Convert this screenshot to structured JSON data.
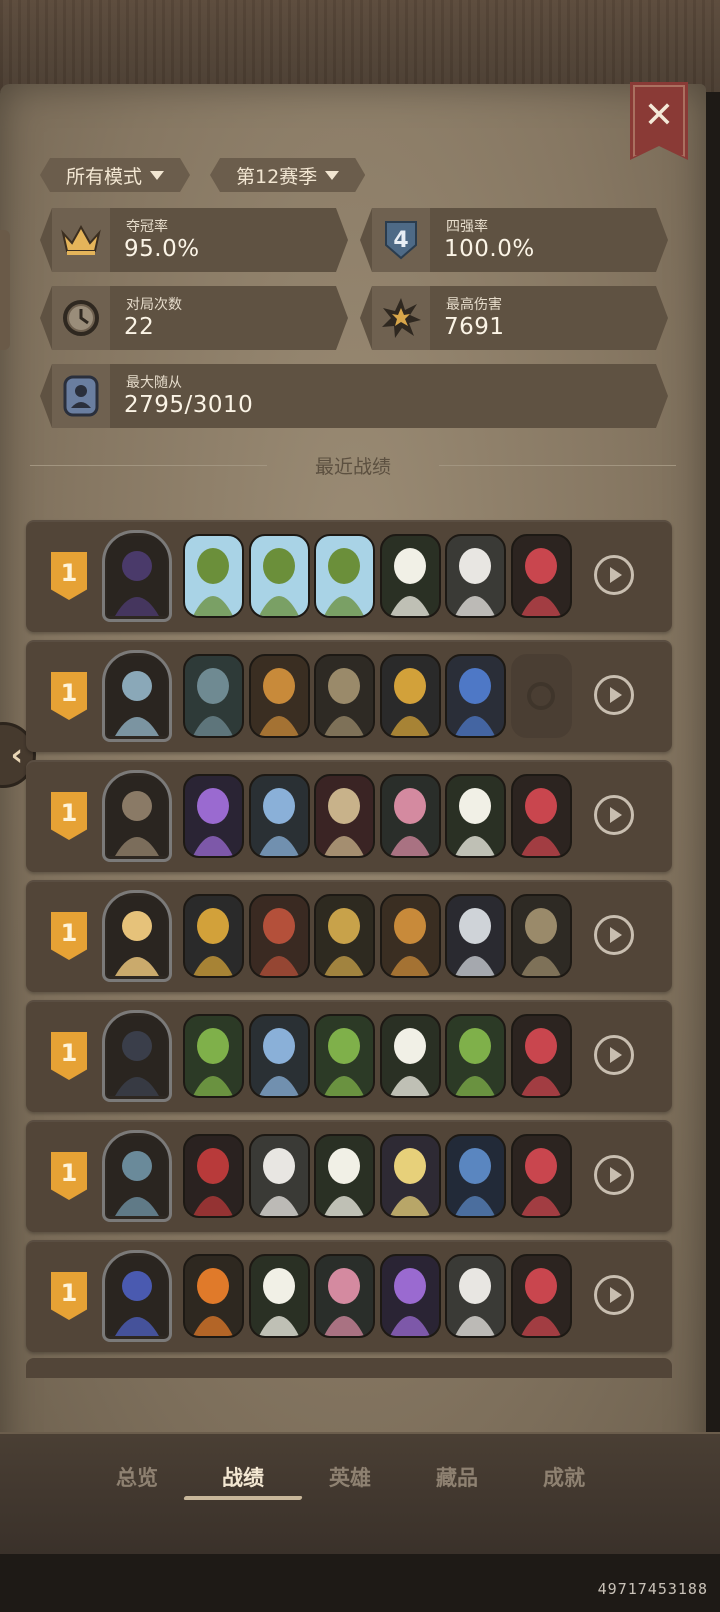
{
  "filters": {
    "mode_label": "所有模式",
    "season_label": "第12赛季"
  },
  "stats": {
    "win_rate": {
      "label": "夺冠率",
      "value": "95.0%"
    },
    "top4_rate": {
      "label": "四强率",
      "value": "100.0%",
      "badge": "4"
    },
    "matches": {
      "label": "对局次数",
      "value": "22"
    },
    "max_damage": {
      "label": "最高伤害",
      "value": "7691"
    },
    "max_minion": {
      "label": "最大随从",
      "value": "2795/3010"
    }
  },
  "recent_title": "最近战绩",
  "matches": [
    {
      "rank": "1",
      "hero": "bat-villain-hero",
      "minions": [
        "tree",
        "tree",
        "tree",
        "flower",
        "white-dress-girl",
        "rose-girl"
      ]
    },
    {
      "rank": "1",
      "hero": "white-beast-hero",
      "minions": [
        "stone-robot",
        "cart-robot",
        "cannon-robot",
        "bomb-robot",
        "blue-orb-robot",
        "empty"
      ]
    },
    {
      "rank": "1",
      "hero": "antler-mask-hero",
      "minions": [
        "purple-flower-fairy",
        "green-hair-girl",
        "harlequin",
        "pink-hair-girl",
        "flower",
        "rose-girl"
      ]
    },
    {
      "rank": "1",
      "hero": "blonde-girl-hero",
      "minions": [
        "bomb-robot",
        "junk-robot",
        "gold-robot",
        "cart-robot",
        "tv-robot",
        "cannon-robot"
      ]
    },
    {
      "rank": "1",
      "hero": "witch-hero",
      "minions": [
        "sapling",
        "green-hair-girl",
        "sapling",
        "flower",
        "sapling",
        "rose-girl"
      ]
    },
    {
      "rank": "1",
      "hero": "goblin-crew-hero",
      "minions": [
        "red-elf",
        "white-dress-girl",
        "flower",
        "blonde-mage",
        "blue-elf",
        "rose-girl"
      ]
    },
    {
      "rank": "1",
      "hero": "blue-hair-hero",
      "minions": [
        "pumpkin-girl",
        "flower",
        "pink-hair-girl",
        "purple-flower-fairy",
        "white-dress-girl",
        "rose-girl"
      ]
    }
  ],
  "nav": {
    "overview": "总览",
    "records": "战绩",
    "heroes": "英雄",
    "collection": "藏品",
    "achievements": "成就"
  },
  "user_id": "49717453188",
  "colors": {
    "panel": "#867762",
    "card": "#524538",
    "badge_gold": "#e6a235",
    "close_red": "#8a3a36"
  }
}
